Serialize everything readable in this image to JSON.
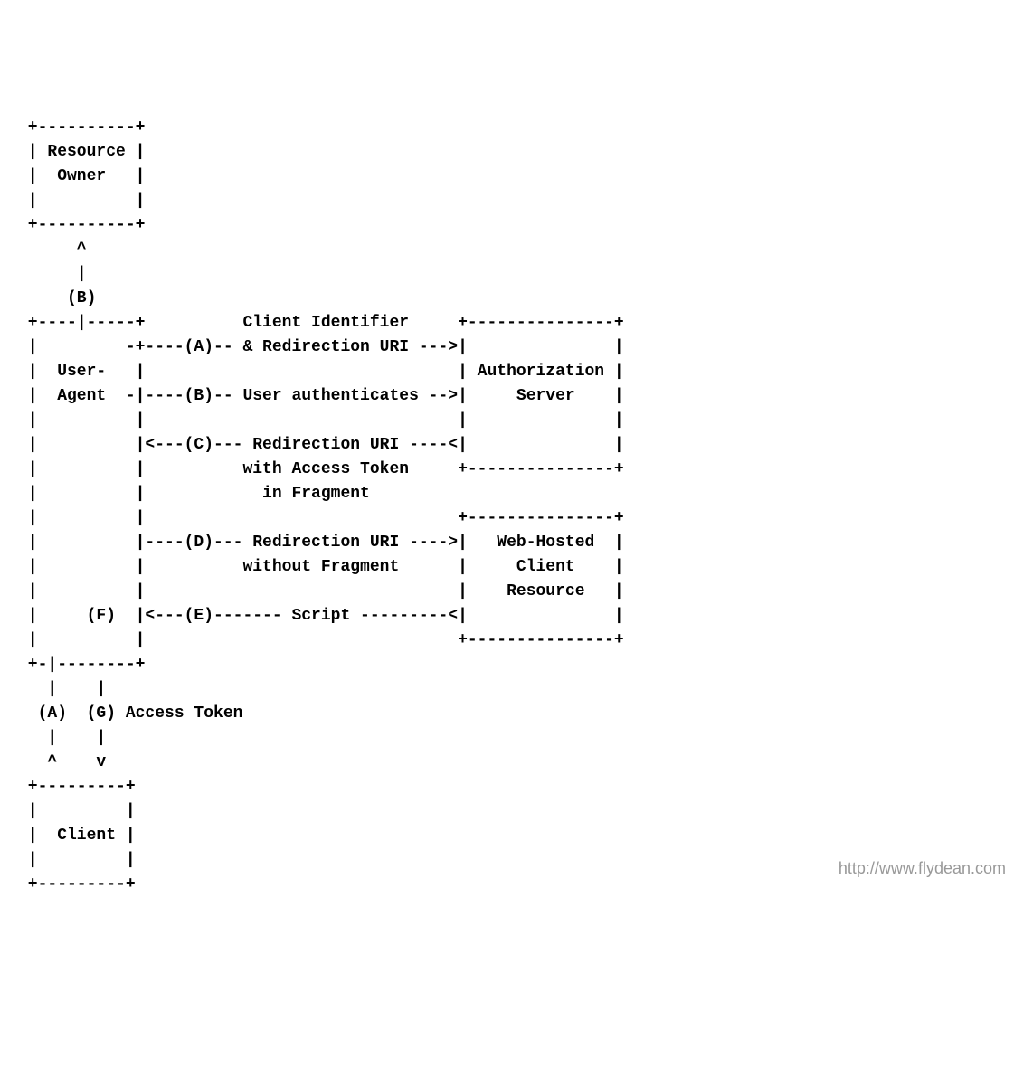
{
  "diagram": {
    "lines": [
      " +----------+",
      " | Resource |",
      " |  Owner   |",
      " |          |",
      " +----------+",
      "      ^",
      "      |",
      "     (B)",
      " +----|-----+          Client Identifier     +---------------+",
      " |         -+----(A)-- & Redirection URI --->|               |",
      " |  User-   |                                | Authorization |",
      " |  Agent  -|----(B)-- User authenticates -->|     Server    |",
      " |          |                                |               |",
      " |          |<---(C)--- Redirection URI ----<|               |",
      " |          |          with Access Token     +---------------+",
      " |          |            in Fragment",
      " |          |                                +---------------+",
      " |          |----(D)--- Redirection URI ---->|   Web-Hosted  |",
      " |          |          without Fragment      |     Client    |",
      " |          |                                |    Resource   |",
      " |     (F)  |<---(E)------- Script ---------<|               |",
      " |          |                                +---------------+",
      " +-|--------+",
      "   |    |",
      "  (A)  (G) Access Token",
      "   |    |",
      "   ^    v",
      " +---------+",
      " |         |",
      " |  Client |",
      " |         |",
      " +---------+"
    ]
  },
  "boxes": {
    "resource_owner": "Resource Owner",
    "user_agent": "User-Agent",
    "authorization_server": "Authorization Server",
    "web_hosted_client_resource": "Web-Hosted Client Resource",
    "client": "Client"
  },
  "flows": {
    "A": "Client Identifier & Redirection URI",
    "B": "User authenticates",
    "C": "Redirection URI with Access Token in Fragment",
    "D": "Redirection URI without Fragment",
    "E": "Script",
    "F": "",
    "G": "Access Token"
  },
  "watermark": "http://www.flydean.com"
}
